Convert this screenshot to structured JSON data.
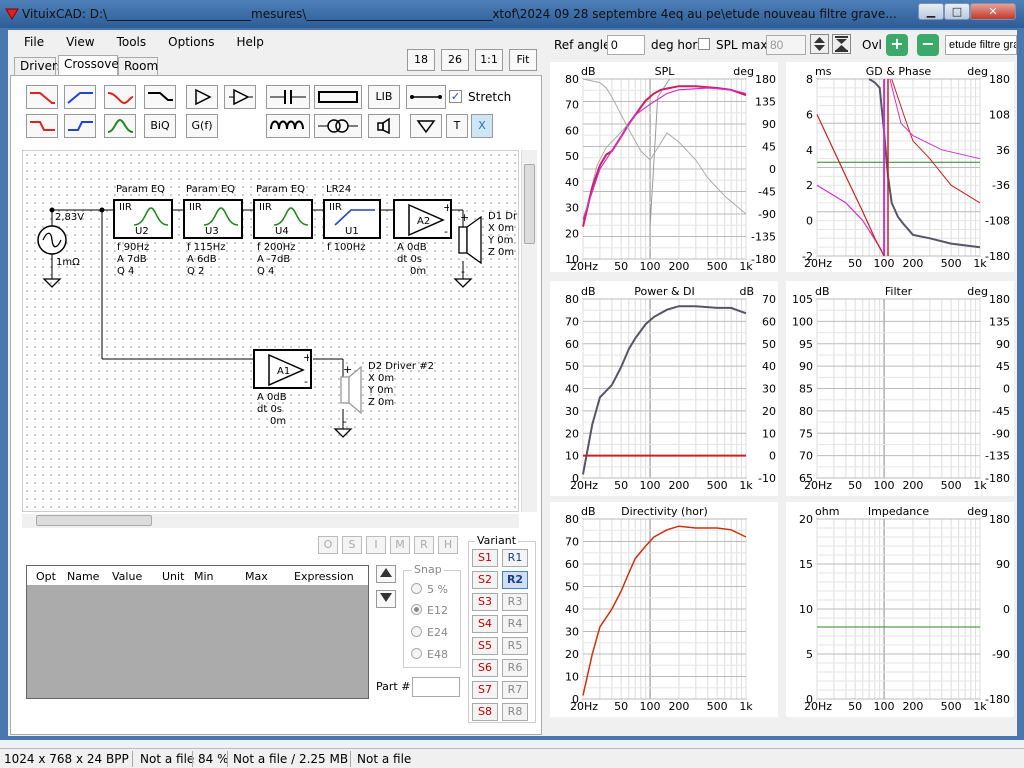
{
  "window": {
    "title": "VituixCAD: D:\\________________________mesures\\_______________________________xtof\\2024 09 28 septembre 4eq au pe\\etude nouveau filtre grave...",
    "min": "▁",
    "max": "□",
    "close": "✕"
  },
  "menu": [
    "File",
    "View",
    "Tools",
    "Options",
    "Help"
  ],
  "zoom_buttons": [
    "18",
    "26",
    "1:1",
    "Fit"
  ],
  "tabs": [
    "Drivers",
    "Crossover",
    "Room"
  ],
  "toolbar": {
    "lib": "LIB",
    "biq": "BiQ",
    "gf": "G(f)",
    "t": "T",
    "x": "X",
    "stretch_label": "Stretch",
    "stretch_checked": true
  },
  "schematic": {
    "source_voltage": "2,83V",
    "source_resistance": "1mΩ",
    "blocks": [
      {
        "title": "Param EQ",
        "type": "IIR",
        "id": "U2",
        "f": "f  90Hz",
        "a": "A  7dB",
        "q": "Q  4"
      },
      {
        "title": "Param EQ",
        "type": "IIR",
        "id": "U3",
        "f": "f  115Hz",
        "a": "A  6dB",
        "q": "Q  2"
      },
      {
        "title": "Param EQ",
        "type": "IIR",
        "id": "U4",
        "f": "f  200Hz",
        "a": "A  -7dB",
        "q": "Q  4"
      },
      {
        "title": "LR24",
        "type": "IIR",
        "id": "U1",
        "f": "f  100Hz",
        "a": "",
        "q": ""
      }
    ],
    "amp_a2": {
      "id": "A2",
      "a": "A  0dB",
      "dt": "dt 0s",
      "extra": "0m"
    },
    "amp_a1": {
      "id": "A1",
      "a": "A  0dB",
      "dt": "dt 0s",
      "extra": "0m"
    },
    "driver1": {
      "name": "D1 Dri",
      "x": "X 0m",
      "y": "Y 0m",
      "z": "Z 0m"
    },
    "driver2": {
      "name": "D2 Driver #2",
      "x": "X 0m",
      "y": "Y 0m",
      "z": "Z 0m"
    }
  },
  "opt_buttons": [
    "O",
    "S",
    "I",
    "M",
    "R",
    "H"
  ],
  "opt_table": {
    "columns": [
      "Opt",
      "Name",
      "Value",
      "Unit",
      "Min",
      "Max",
      "Expression"
    ]
  },
  "snap": {
    "label": "Snap",
    "options": [
      "5 %",
      "E12",
      "E24",
      "E48"
    ],
    "selected": "E12"
  },
  "part_label": "Part #",
  "variant": {
    "label": "Variant",
    "s": [
      "S1",
      "S2",
      "S3",
      "S4",
      "S5",
      "S6",
      "S7",
      "S8"
    ],
    "r": [
      "R1",
      "R2",
      "R3",
      "R4",
      "R5",
      "R6",
      "R7",
      "R8"
    ],
    "selected": "R2"
  },
  "top_controls": {
    "ref_angle_label": "Ref angle",
    "ref_angle_value": "0",
    "deg_hor": "deg hor",
    "spl_max_label": "SPL max",
    "spl_max_value": "80",
    "ovl_label": "Ovl",
    "filename": "etude filtre gra"
  },
  "charts": {
    "spl": {
      "title": "SPL",
      "left_unit": "dB",
      "right_unit": "deg",
      "yl": [
        "80",
        "70",
        "60",
        "50",
        "40",
        "30",
        "20",
        "10"
      ],
      "yr": [
        "180",
        "135",
        "90",
        "45",
        "0",
        "-45",
        "-90",
        "-135",
        "-180"
      ],
      "x": [
        "20Hz",
        "50",
        "100",
        "200",
        "500",
        "1k"
      ]
    },
    "gd": {
      "title": "GD & Phase",
      "left_unit": "ms",
      "right_unit": "deg",
      "yl": [
        "8",
        "6",
        "4",
        "2",
        "0",
        "-2"
      ],
      "yr": [
        "180",
        "108",
        "36",
        "-36",
        "-108",
        "-180"
      ],
      "x": [
        "20Hz",
        "50",
        "100",
        "200",
        "500",
        "1k"
      ]
    },
    "power": {
      "title": "Power & DI",
      "left_unit": "dB",
      "right_unit": "dB",
      "yl": [
        "80",
        "70",
        "60",
        "50",
        "40",
        "30",
        "20",
        "10",
        "0"
      ],
      "yr": [
        "70",
        "60",
        "50",
        "40",
        "30",
        "20",
        "10",
        "0",
        "-10"
      ],
      "x": [
        "20Hz",
        "50",
        "100",
        "200",
        "500",
        "1k"
      ]
    },
    "filter": {
      "title": "Filter",
      "left_unit": "dB",
      "right_unit": "deg",
      "yl": [
        "105",
        "100",
        "95",
        "90",
        "85",
        "80",
        "75",
        "70",
        "65"
      ],
      "yr": [
        "180",
        "135",
        "90",
        "45",
        "0",
        "-45",
        "-90",
        "-135",
        "-180"
      ],
      "x": [
        "20Hz",
        "50",
        "100",
        "200",
        "500",
        "1k"
      ]
    },
    "directivity": {
      "title": "Directivity (hor)",
      "left_unit": "dB",
      "right_unit": "",
      "yl": [
        "80",
        "70",
        "60",
        "50",
        "40",
        "30",
        "20",
        "10",
        "0"
      ],
      "yr": [],
      "x": [
        "20Hz",
        "50",
        "100",
        "200",
        "500",
        "1k"
      ]
    },
    "impedance": {
      "title": "Impedance",
      "left_unit": "ohm",
      "right_unit": "deg",
      "yl": [
        "20",
        "15",
        "10",
        "5",
        "0"
      ],
      "yr": [
        "180",
        "90",
        "0",
        "-90",
        "-180"
      ],
      "x": [
        "20Hz",
        "50",
        "100",
        "200",
        "500",
        "1k"
      ]
    }
  },
  "status": {
    "dims": "1024 x 768 x 24 BPP",
    "file1": "Not a file",
    "zoom": "84 %",
    "file2": "Not a file / 2.25 MB",
    "file3": "Not a file"
  },
  "colors": {
    "accent": "#2d5d97",
    "curve_red": "#cc2020",
    "curve_pink": "#cc33cc",
    "curve_grey": "#555566",
    "curve_green": "#228822"
  }
}
